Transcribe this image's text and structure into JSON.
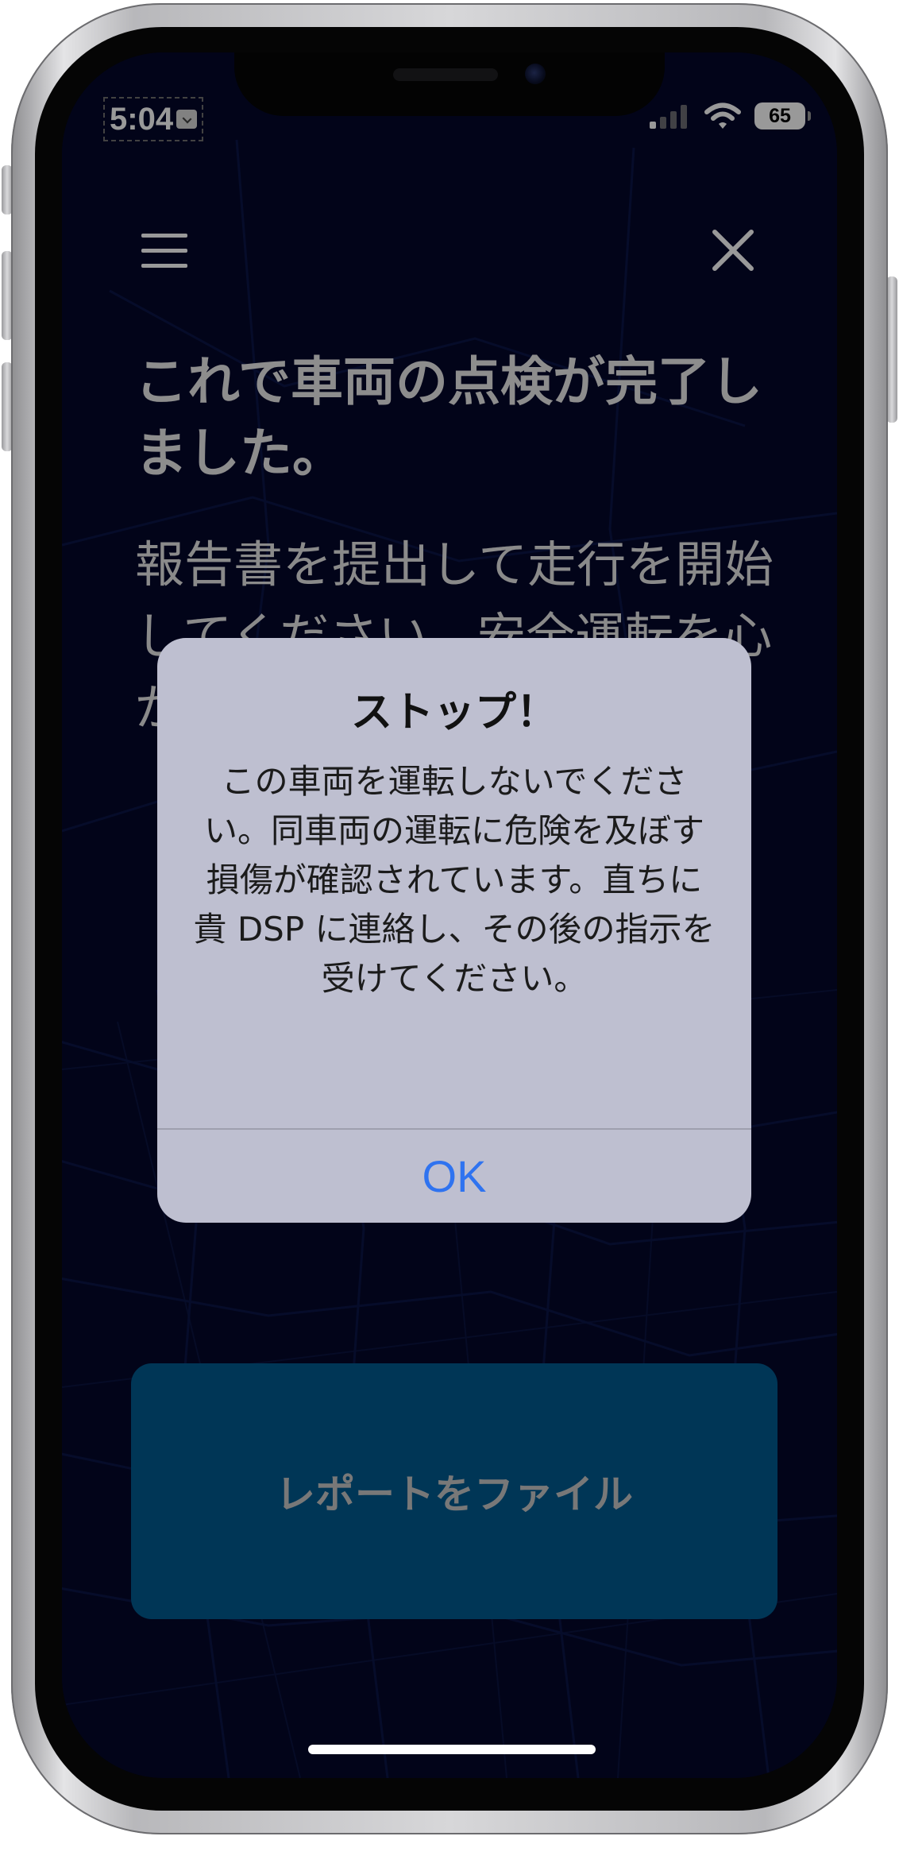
{
  "status_bar": {
    "time": "5:04",
    "battery": "65"
  },
  "header": {
    "menu_icon": "hamburger-menu-icon",
    "close_icon": "close-icon"
  },
  "main": {
    "heading": "これで車両の点検が完了しました。",
    "body": "報告書を提出して走行を開始してください。安全運転を心がけてください。"
  },
  "alert": {
    "title": "ストップ！",
    "message": "この車両を運転しないでください。同車両の運転に危険を及ぼす損傷が確認されています。直ちに貴 DSP に連絡し、その後の指示を受けてください。",
    "ok_label": "OK"
  },
  "actions": {
    "file_report_label": "レポートをファイル"
  },
  "colors": {
    "screen_background": "#04082a",
    "primary_button": "#005a90",
    "alert_background": "#bebfd0",
    "alert_action": "#2f73f0"
  }
}
